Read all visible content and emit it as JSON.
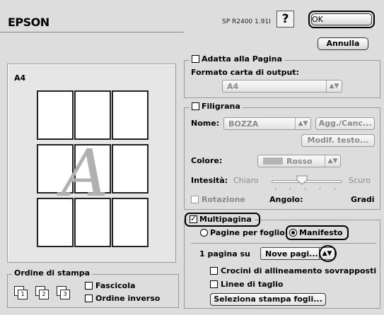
{
  "header": {
    "brand": "EPSON",
    "version": "SP R2400 1.91I",
    "help_label": "?",
    "ok_label": "OK",
    "cancel_label": "Annulla"
  },
  "preview": {
    "paper_label": "A4",
    "watermark_glyph": "A"
  },
  "fit_to_page": {
    "title": "Adatta alla Pagina",
    "checked": false,
    "output_label": "Formato carta di output:",
    "output_value": "A4"
  },
  "watermark": {
    "title": "Filigrana",
    "checked": false,
    "name_label": "Nome:",
    "name_value": "BOZZA",
    "add_delete_button": "Agg./Canc...",
    "edit_text_button": "Modif. testo...",
    "color_label": "Colore:",
    "color_value": "Rosso",
    "intensity_label": "Intesità:",
    "intensity_low": "Chiaro",
    "intensity_high": "Scuro",
    "rotation_label": "Rotazione",
    "angle_label": "Angolo:",
    "degrees_label": "Gradi"
  },
  "multipage": {
    "title": "Multipagina",
    "checked": true,
    "option_pages_per_sheet": "Pagine per foglio",
    "option_poster": "Manifesto",
    "selected_option": "Manifesto",
    "one_page_on_label": "1 pagina su",
    "one_page_on_value": "Nove pagi...",
    "crop_marks_label": "Crocini di allineamento sovrapposti",
    "cut_lines_label": "Linee di taglio",
    "select_sheets_button": "Seleziona stampa fogli..."
  },
  "print_order": {
    "title": "Ordine di stampa",
    "collate_label": "Fascicola",
    "reverse_label": "Ordine inverso",
    "icon_numbers": [
      "1",
      "2",
      "3"
    ]
  }
}
